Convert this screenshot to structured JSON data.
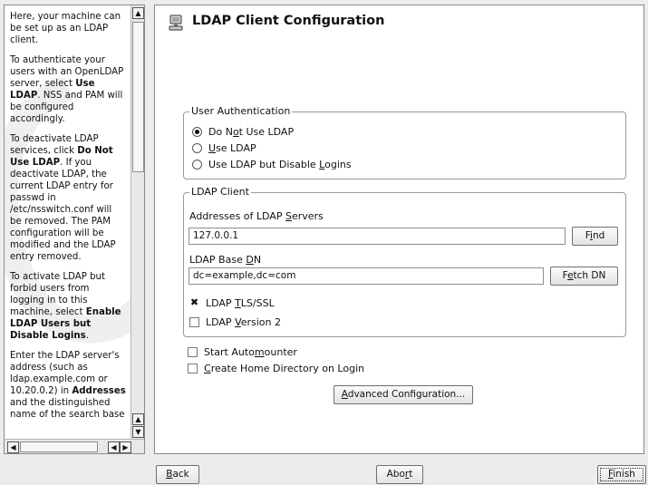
{
  "help": {
    "p1": "Here, your machine can be set up as an LDAP client.",
    "p2a": "To authenticate your users with an OpenLDAP server, select ",
    "p2b": "Use LDAP",
    "p2c": ". NSS and PAM will be configured accordingly.",
    "p3a": "To deactivate LDAP services, click ",
    "p3b": "Do Not Use LDAP",
    "p3c": ". If you deactivate LDAP, the current LDAP entry for passwd in /etc/nsswitch.conf will be removed. The PAM configuration will be modified and the LDAP entry removed.",
    "p4a": "To activate LDAP but forbid users from logging in to this machine, select ",
    "p4b": "Enable LDAP Users but Disable Logins",
    "p4c": ".",
    "p5a": "Enter the LDAP server's address (such as ldap.example.com or 10.20.0.2) in ",
    "p5b": "Addresses",
    "p5c": " and the distinguished name of the search base"
  },
  "title": "LDAP Client Configuration",
  "auth": {
    "legend": "User Authentication",
    "opt1": {
      "pre": "Do N",
      "acc": "o",
      "post": "t Use LDAP"
    },
    "opt2": {
      "pre": "",
      "acc": "U",
      "post": "se LDAP"
    },
    "opt3": {
      "pre": "Use LDAP but Disable ",
      "acc": "L",
      "post": "ogins"
    },
    "selected": "Do Not Use LDAP"
  },
  "client": {
    "legend": "LDAP Client",
    "servers_label": {
      "pre": "Addresses of LDAP ",
      "acc": "S",
      "post": "ervers"
    },
    "servers_value": "127.0.0.1",
    "find": {
      "pre": "F",
      "acc": "i",
      "post": "nd"
    },
    "basedn_label": {
      "pre": "LDAP Base ",
      "acc": "D",
      "post": "N"
    },
    "basedn_value": "dc=example,dc=com",
    "fetch": {
      "pre": "F",
      "acc": "e",
      "post": "tch DN"
    },
    "tls": {
      "pre": "LDAP ",
      "acc": "T",
      "post": "LS/SSL",
      "checked": true
    },
    "v2": {
      "pre": "LDAP ",
      "acc": "V",
      "post": "ersion 2",
      "checked": false
    }
  },
  "automounter": {
    "pre": "Start Auto",
    "acc": "m",
    "post": "ounter",
    "checked": false
  },
  "homedir": {
    "pre": "",
    "acc": "C",
    "post": "reate Home Directory on Login",
    "checked": false
  },
  "advanced": {
    "pre": "",
    "acc": "A",
    "post": "dvanced Configuration..."
  },
  "footer": {
    "back": {
      "pre": "",
      "acc": "B",
      "post": "ack"
    },
    "abort": {
      "pre": "Abo",
      "acc": "r",
      "post": "t"
    },
    "finish": {
      "pre": "",
      "acc": "F",
      "post": "inish"
    }
  }
}
